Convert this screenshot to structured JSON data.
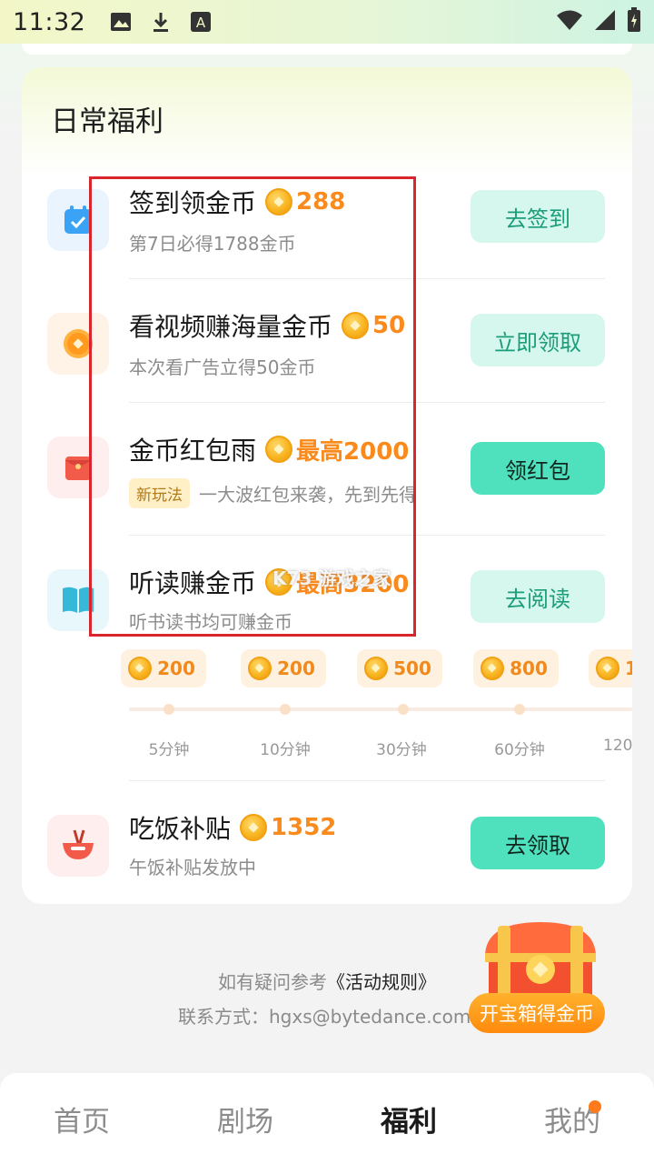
{
  "status_bar": {
    "time": "11:32",
    "icons": [
      "image-icon",
      "download-icon",
      "font-a-icon",
      "wifi-icon",
      "signal-icon",
      "battery-icon"
    ],
    "font_icon_letter": "A"
  },
  "section": {
    "title": "日常福利"
  },
  "tasks": [
    {
      "title": "签到领金币",
      "reward": "288",
      "subtitle": "第7日必得1788金币",
      "button": "去签到",
      "icon": "calendar-icon"
    },
    {
      "title": "看视频赚海量金币",
      "reward": "50",
      "subtitle": "本次看广告立得50金币",
      "button": "立即领取",
      "icon": "coin-icon"
    },
    {
      "title": "金币红包雨",
      "reward": "最高2000",
      "badge": "新玩法",
      "subtitle": "一大波红包来袭，先到先得",
      "button": "领红包",
      "icon": "red-envelope-icon"
    },
    {
      "title": "听读赚金币",
      "reward": "最高3200",
      "subtitle": "听书读书均可赚金币",
      "button": "去阅读",
      "icon": "book-icon"
    },
    {
      "title": "吃饭补贴",
      "reward": "1352",
      "subtitle": "午饭补贴发放中",
      "button": "去领取",
      "icon": "rice-bowl-icon"
    }
  ],
  "milestones": [
    {
      "coins": "200",
      "label": "5分钟"
    },
    {
      "coins": "200",
      "label": "10分钟"
    },
    {
      "coins": "500",
      "label": "30分钟"
    },
    {
      "coins": "800",
      "label": "60分钟"
    },
    {
      "coins": "1",
      "label": "120"
    }
  ],
  "watermark": "K73 游戏之家",
  "footer": {
    "question_prefix": "如有疑问参考",
    "rules_link": "《活动规则》",
    "contact": "联系方式：hgxs@bytedance.com"
  },
  "treasure": {
    "label": "开宝箱得金币"
  },
  "tabs": [
    "首页",
    "剧场",
    "福利",
    "我的"
  ],
  "active_tab": "福利",
  "colors": {
    "accent_green": "#4fe0bd",
    "reward_orange": "#fb8a1c",
    "highlight_red": "#d9262c"
  }
}
